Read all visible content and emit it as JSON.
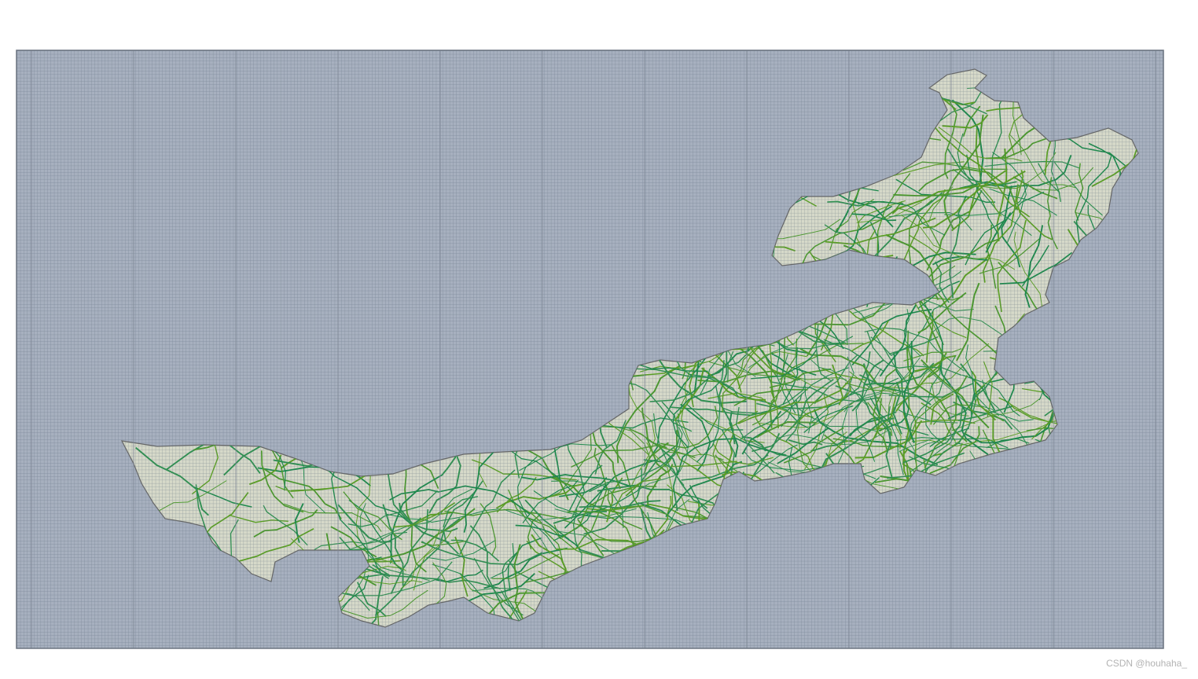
{
  "map": {
    "grid_color": "#6f7c8c",
    "ocean_fill": "#a7b0bf",
    "land_fill": "#d6d9c9",
    "road_color_primary": "#1a8a4a",
    "road_color_secondary": "#5aa021",
    "border_color": "#6b6b6b"
  },
  "watermark": {
    "text": "CSDN @houhaha_"
  }
}
